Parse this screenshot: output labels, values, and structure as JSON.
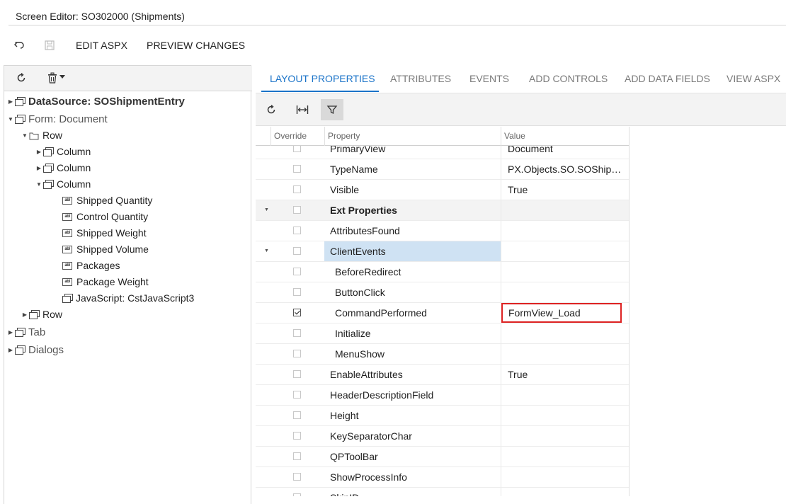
{
  "window": {
    "title": "Screen Editor: SO302000 (Shipments)"
  },
  "toolbar": {
    "undo_icon": "undo-icon",
    "save_icon": "save-icon",
    "edit_aspx": "EDIT ASPX",
    "preview_changes": "PREVIEW CHANGES"
  },
  "tree": {
    "toolbar": {
      "refresh_icon": "refresh-icon",
      "delete_icon": "trash-icon",
      "dropdown_icon": "caret-down-icon"
    },
    "nodes": [
      {
        "label": "DataSource: SOShipmentEntry"
      },
      {
        "label": "Form: Document"
      },
      {
        "label": "Row"
      },
      {
        "label": "Column"
      },
      {
        "label": "Column"
      },
      {
        "label": "Column"
      },
      {
        "label": "Shipped Quantity"
      },
      {
        "label": "Control Quantity"
      },
      {
        "label": "Shipped Weight"
      },
      {
        "label": "Shipped Volume"
      },
      {
        "label": "Packages"
      },
      {
        "label": "Package Weight"
      },
      {
        "label": "JavaScript: CstJavaScript3"
      },
      {
        "label": "Row"
      },
      {
        "label": "Tab"
      },
      {
        "label": "Dialogs"
      }
    ]
  },
  "tabs": [
    {
      "label": "LAYOUT PROPERTIES",
      "active": true
    },
    {
      "label": "ATTRIBUTES"
    },
    {
      "label": "EVENTS"
    },
    {
      "label": "ADD CONTROLS"
    },
    {
      "label": "ADD DATA FIELDS"
    },
    {
      "label": "VIEW ASPX"
    }
  ],
  "grid": {
    "columns": {
      "override": "Override",
      "property": "Property",
      "value": "Value"
    },
    "rows": [
      {
        "property": "PrimaryView",
        "value": "Document",
        "checked": false
      },
      {
        "property": "TypeName",
        "value": "PX.Objects.SO.SOShipm…",
        "checked": false
      },
      {
        "property": "Visible",
        "value": "True",
        "checked": false
      },
      {
        "property": "Ext Properties",
        "value": "",
        "checked": false,
        "group": true,
        "expanded": true
      },
      {
        "property": "AttributesFound",
        "value": "",
        "checked": false
      },
      {
        "property": "ClientEvents",
        "value": "",
        "checked": false,
        "expanded": true,
        "selected": true
      },
      {
        "property": "BeforeRedirect",
        "value": "",
        "checked": false,
        "indent": true
      },
      {
        "property": "ButtonClick",
        "value": "",
        "checked": false,
        "indent": true
      },
      {
        "property": "CommandPerformed",
        "value": "FormView_Load",
        "checked": true,
        "indent": true,
        "highlight": true
      },
      {
        "property": "Initialize",
        "value": "",
        "checked": false,
        "indent": true
      },
      {
        "property": "MenuShow",
        "value": "",
        "checked": false,
        "indent": true
      },
      {
        "property": "EnableAttributes",
        "value": "True",
        "checked": false
      },
      {
        "property": "HeaderDescriptionField",
        "value": "",
        "checked": false
      },
      {
        "property": "Height",
        "value": "",
        "checked": false
      },
      {
        "property": "KeySeparatorChar",
        "value": "",
        "checked": false
      },
      {
        "property": "QPToolBar",
        "value": "",
        "checked": false
      },
      {
        "property": "ShowProcessInfo",
        "value": "",
        "checked": false
      },
      {
        "property": "SkinID",
        "value": "",
        "checked": false
      }
    ]
  },
  "colors": {
    "accent": "#1a73c8",
    "highlight_border": "#dd2222",
    "selected_row": "#cfe2f3"
  }
}
